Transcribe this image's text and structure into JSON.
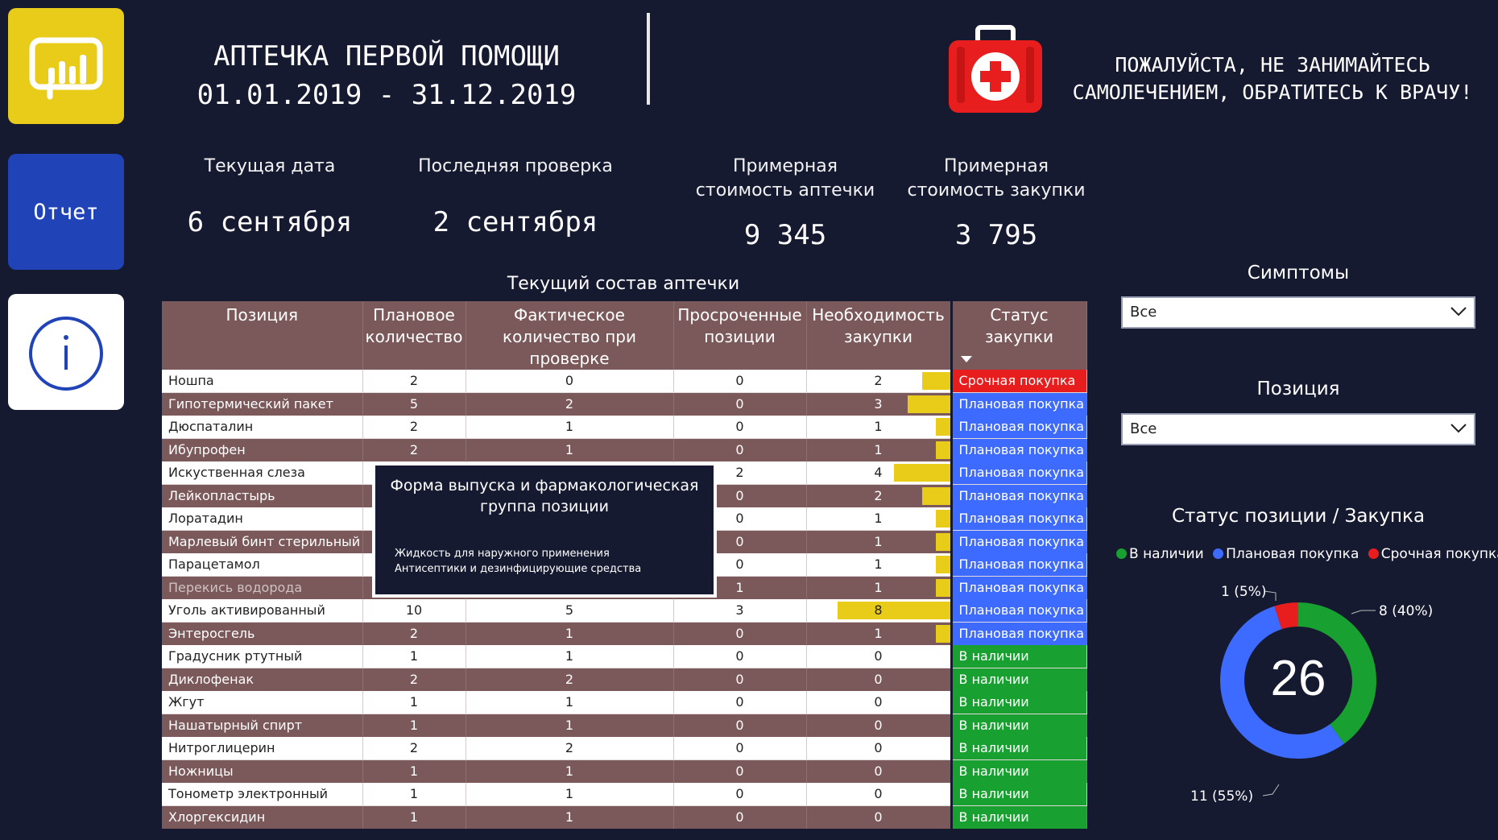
{
  "header": {
    "title": "АПТЕЧКА ПЕРВОЙ ПОМОЩИ",
    "period": "01.01.2019 - 31.12.2019",
    "warning_line1": "ПОЖАЛУЙСТА, НЕ ЗАНИМАЙТЕСЬ",
    "warning_line2": "САМОЛЕЧЕНИЕМ, ОБРАТИТЕСЬ К ВРАЧУ!"
  },
  "nav": {
    "report_label": "Отчет"
  },
  "kpis": {
    "current_date_label": "Текущая дата",
    "current_date_value": "6 сентября",
    "last_check_label": "Последняя проверка",
    "last_check_value": "2 сентября",
    "kit_cost_label_1": "Примерная",
    "kit_cost_label_2": "стоимость аптечки",
    "kit_cost_value": "9 345",
    "purchase_cost_label_1": "Примерная",
    "purchase_cost_label_2": "стоимость закупки",
    "purchase_cost_value": "3 795"
  },
  "table": {
    "title": "Текущий состав аптечки",
    "columns": [
      "Позиция",
      "Плановое количество",
      "Фактическое количество при проверке",
      "Просроченные позиции",
      "Необходимость закупки",
      "Статус закупки"
    ],
    "rows": [
      {
        "name": "Ношпа",
        "plan": "2",
        "fact": "0",
        "expired": "0",
        "need": "2",
        "status": "Срочная покупка"
      },
      {
        "name": "Гипотермический пакет",
        "plan": "5",
        "fact": "2",
        "expired": "0",
        "need": "3",
        "status": "Плановая покупка"
      },
      {
        "name": "Дюспаталин",
        "plan": "2",
        "fact": "1",
        "expired": "0",
        "need": "1",
        "status": "Плановая покупка"
      },
      {
        "name": "Ибупрофен",
        "plan": "2",
        "fact": "1",
        "expired": "0",
        "need": "1",
        "status": "Плановая покупка"
      },
      {
        "name": "Искуственная слеза",
        "plan": "",
        "fact": "",
        "expired": "2",
        "need": "4",
        "status": "Плановая покупка"
      },
      {
        "name": "Лейкопластырь",
        "plan": "",
        "fact": "",
        "expired": "0",
        "need": "2",
        "status": "Плановая покупка"
      },
      {
        "name": "Лоратадин",
        "plan": "",
        "fact": "",
        "expired": "0",
        "need": "1",
        "status": "Плановая покупка"
      },
      {
        "name": "Марлевый бинт стерильный",
        "plan": "",
        "fact": "",
        "expired": "0",
        "need": "1",
        "status": "Плановая покупка"
      },
      {
        "name": "Парацетамол",
        "plan": "",
        "fact": "",
        "expired": "0",
        "need": "1",
        "status": "Плановая покупка"
      },
      {
        "name": "Перекись водорода",
        "plan": "",
        "fact": "",
        "expired": "1",
        "need": "1",
        "status": "Плановая покупка"
      },
      {
        "name": "Уголь активированный",
        "plan": "10",
        "fact": "5",
        "expired": "3",
        "need": "8",
        "status": "Плановая покупка"
      },
      {
        "name": "Энтеросгель",
        "plan": "2",
        "fact": "1",
        "expired": "0",
        "need": "1",
        "status": "Плановая покупка"
      },
      {
        "name": "Градусник ртутный",
        "plan": "1",
        "fact": "1",
        "expired": "0",
        "need": "0",
        "status": "В наличии"
      },
      {
        "name": "Диклофенак",
        "plan": "2",
        "fact": "2",
        "expired": "0",
        "need": "0",
        "status": "В наличии"
      },
      {
        "name": "Жгут",
        "plan": "1",
        "fact": "1",
        "expired": "0",
        "need": "0",
        "status": "В наличии"
      },
      {
        "name": "Нашатырный спирт",
        "plan": "1",
        "fact": "1",
        "expired": "0",
        "need": "0",
        "status": "В наличии"
      },
      {
        "name": "Нитроглицерин",
        "plan": "2",
        "fact": "2",
        "expired": "0",
        "need": "0",
        "status": "В наличии"
      },
      {
        "name": "Ножницы",
        "plan": "1",
        "fact": "1",
        "expired": "0",
        "need": "0",
        "status": "В наличии"
      },
      {
        "name": "Тонометр электронный",
        "plan": "1",
        "fact": "1",
        "expired": "0",
        "need": "0",
        "status": "В наличии"
      },
      {
        "name": "Хлоргексидин",
        "plan": "1",
        "fact": "1",
        "expired": "0",
        "need": "0",
        "status": "В наличии"
      }
    ],
    "need_max": 8
  },
  "tooltip": {
    "title_line1": "Форма выпуска и фармакологическая",
    "title_line2": "группа позиции",
    "line1": "Жидкость для наружного применения",
    "line2": "Антисептики и дезинфицирующие средства"
  },
  "filters": {
    "symptoms_label": "Симптомы",
    "symptoms_value": "Все",
    "position_label": "Позиция",
    "position_value": "Все"
  },
  "donut": {
    "title": "Статус позиции / Закупка",
    "center_value": "26",
    "legend": [
      "В наличии",
      "Плановая покупка",
      "Срочная покупка"
    ],
    "labels": {
      "in_stock": "8 (40%)",
      "planned": "11 (55%)",
      "urgent": "1 (5%)"
    }
  },
  "colors": {
    "background": "#161a30",
    "accent_yellow": "#e9cc1a",
    "nav_blue": "#2043b8",
    "table_header": "#7b5859",
    "status_urgent": "#e81e1e",
    "status_planned": "#3e6bff",
    "status_in_stock": "#18a030"
  },
  "chart_data": {
    "type": "pie",
    "title": "Статус позиции / Закупка",
    "categories": [
      "В наличии",
      "Плановая покупка",
      "Срочная покупка"
    ],
    "values": [
      8,
      11,
      1
    ],
    "percentages": [
      40,
      55,
      5
    ],
    "center_value": 26,
    "legend_position": "top"
  }
}
